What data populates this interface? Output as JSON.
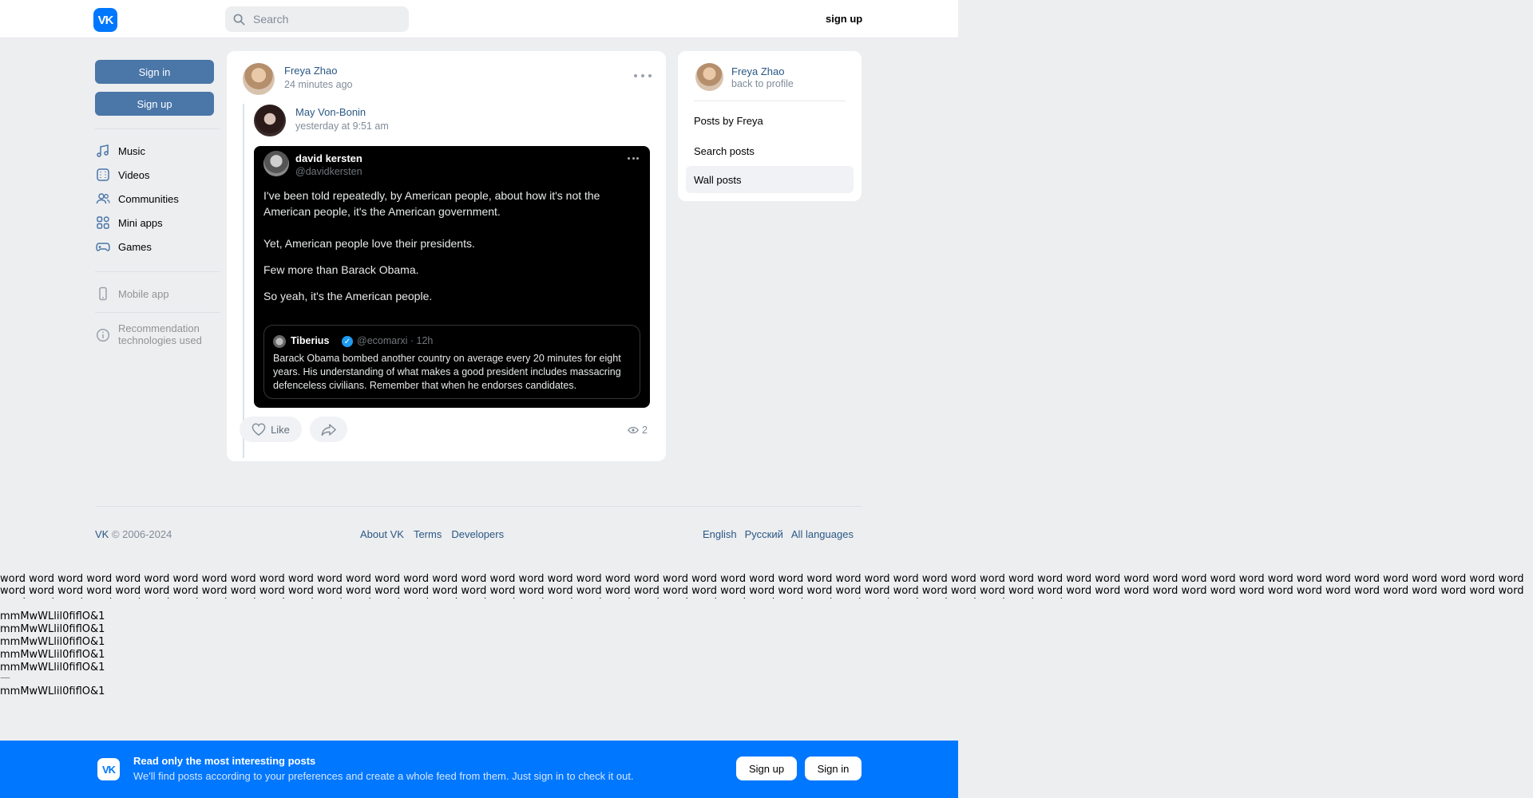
{
  "header": {
    "logo_text": "VK",
    "search_placeholder": "Search",
    "signup_label": "sign up"
  },
  "sidebar": {
    "sign_in": "Sign in",
    "sign_up": "Sign up",
    "items": [
      {
        "label": "Music",
        "icon": "music-icon"
      },
      {
        "label": "Videos",
        "icon": "video-icon"
      },
      {
        "label": "Communities",
        "icon": "communities-icon"
      },
      {
        "label": "Mini apps",
        "icon": "mini-apps-icon"
      },
      {
        "label": "Games",
        "icon": "games-icon"
      }
    ],
    "mobile_app": "Mobile app",
    "recommendation_line1": "Recommendation",
    "recommendation_line2": "technologies used"
  },
  "post": {
    "author": "Freya Zhao",
    "time": "24 minutes ago",
    "repost": {
      "author": "May Von-Bonin",
      "time": "yesterday at 9:51 am"
    },
    "tweet": {
      "name": "david kersten",
      "handle": "@davidkersten",
      "p1": "I've been told repeatedly, by American people, about how it's not the American people, it's the American government.",
      "p2": "Yet, American people love their presidents.",
      "p3": "Few more than Barack Obama.",
      "p4": "So yeah, it's the American people.",
      "quote": {
        "name": "Tiberius",
        "meta": "@ecomarxi · 12h",
        "text": "Barack Obama bombed another country on average every 20 minutes for eight years. His understanding of what makes a good president includes massacring defenceless civilians. Remember that when he endorses candidates."
      }
    },
    "like_label": "Like",
    "views": "2"
  },
  "right_menu": {
    "name": "Freya Zhao",
    "back": "back to profile",
    "items": [
      "Posts by Freya",
      "Search posts",
      "Wall posts"
    ],
    "active_index": 2
  },
  "footer": {
    "copyright_brand": "VK",
    "copyright_years": " © 2006-2024",
    "links": [
      "About VK",
      "Terms",
      "Developers"
    ],
    "languages": [
      "English",
      "Русский",
      "All languages"
    ]
  },
  "debug": {
    "word_line": "word word word word word word word word word word word word word word word word word word word word word word word word word word word word word word word word word word word word word word word word word word word word word word word word word word word word word word word word word word word word word word word word word word word word word word word word word word word word word word word word word word word word word word word word word word word word word word word word word word word word word word word word word word word word word word word word word word word word word word word word word word word word word word word word word word word word word word word word word word word word word word word",
    "glyph_line": "mmMwWLlil0fiflO&1",
    "dash": "—"
  },
  "banner": {
    "logo_text": "VK",
    "title": "Read only the most interesting posts",
    "subtitle": "We'll find posts according to your preferences and create a whole feed from them. Just sign in to check it out.",
    "signup": "Sign up",
    "signin": "Sign in"
  },
  "colors": {
    "brand": "#0077ff",
    "button": "#4a76a8",
    "link": "#2a5885",
    "background": "#edeef0"
  }
}
